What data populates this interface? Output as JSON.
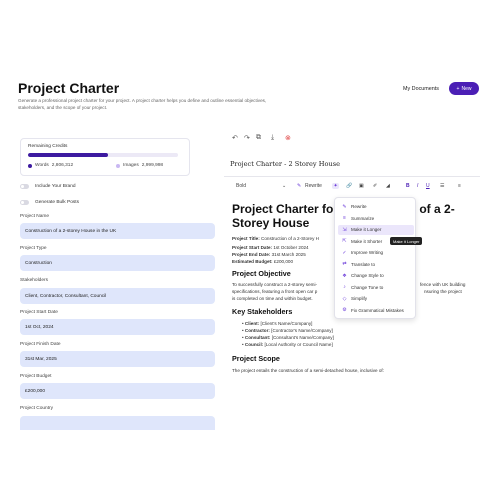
{
  "header": {
    "title": "Project Charter",
    "description": "Generate a professional project charter for your project. A project charter helps you define and outline essential objectives, stakeholders, and the scope of your project.",
    "my_documents": "My Documents",
    "new_button": "New"
  },
  "credits": {
    "title": "Remaining Credits",
    "words_label": "Words",
    "words_value": "2,806,312",
    "images_label": "Images",
    "images_value": "2,999,998",
    "words_used_fraction": 0.53,
    "words_color": "#3d1aa0",
    "images_color": "#c9b8f2"
  },
  "toggles": [
    {
      "label": "Include Your Brand",
      "on": false
    },
    {
      "label": "Generate Bulk Posts",
      "on": false
    }
  ],
  "fields": [
    {
      "label": "Project Name",
      "value": "Construction of a 2-storey House in the UK"
    },
    {
      "label": "Project Type",
      "value": "Construction"
    },
    {
      "label": "Stakeholders",
      "value": "Client, Contractor, Consultant, Council"
    },
    {
      "label": "Project Start Date",
      "value": "1st Oct, 2024"
    },
    {
      "label": "Project Finish Date",
      "value": "31st Mar, 2025"
    },
    {
      "label": "Project Budget",
      "value": "£200,000"
    },
    {
      "label": "Project Country",
      "value": ""
    }
  ],
  "editor": {
    "doc_title": "Project Charter - 2 Storey House",
    "format_block": "Bold",
    "rewrite_label": "Rewrite",
    "h1": "Project Charter for Construction of a 2-Storey House",
    "meta": {
      "title_label": "Project Title:",
      "title_value": "Construction of a 2-Storey H",
      "start_label": "Project Start Date:",
      "start_value": "1st October 2024",
      "end_label": "Project End Date:",
      "end_value": "31st March 2025",
      "budget_label": "Estimated Budget:",
      "budget_value": "£200,000"
    },
    "objective_heading": "Project Objective",
    "objective_text_1": "To successfully construct a 2-storey semi-",
    "objective_text_1b": "fence with UK building",
    "objective_text_2": "specifications, featuring a front open car p",
    "objective_text_2b": "nsuring the project",
    "objective_text_3": "is completed on time and within budget.",
    "stakeholders_heading": "Key Stakeholders",
    "stakeholders": [
      {
        "label": "Client:",
        "value": "[Client's Name/Company]"
      },
      {
        "label": "Contractor:",
        "value": "[Contractor's Name/Company]"
      },
      {
        "label": "Consultant:",
        "value": "[Consultant's Name/Company]"
      },
      {
        "label": "Council:",
        "value": "[Local Authority or Council Name]"
      }
    ],
    "scope_heading": "Project Scope",
    "scope_text": "The project entails the construction of a semi-detached house, inclusive of:"
  },
  "ai_menu": {
    "items": [
      {
        "label": "Rewrite",
        "icon": "pen-icon"
      },
      {
        "label": "Summarize",
        "icon": "lines-icon"
      },
      {
        "label": "Make it Longer",
        "icon": "expand-icon",
        "active": true
      },
      {
        "label": "Make it Shorter",
        "icon": "shrink-icon"
      },
      {
        "label": "Improve Writing",
        "icon": "check-icon"
      },
      {
        "label": "Translate to",
        "icon": "translate-icon"
      },
      {
        "label": "Change Style to",
        "icon": "style-icon"
      },
      {
        "label": "Change Tone to",
        "icon": "tone-icon"
      },
      {
        "label": "Simplify",
        "icon": "simplify-icon"
      },
      {
        "label": "Fix Grammatical Mistakes",
        "icon": "grammar-icon"
      }
    ],
    "tooltip": "Make it Longer"
  }
}
